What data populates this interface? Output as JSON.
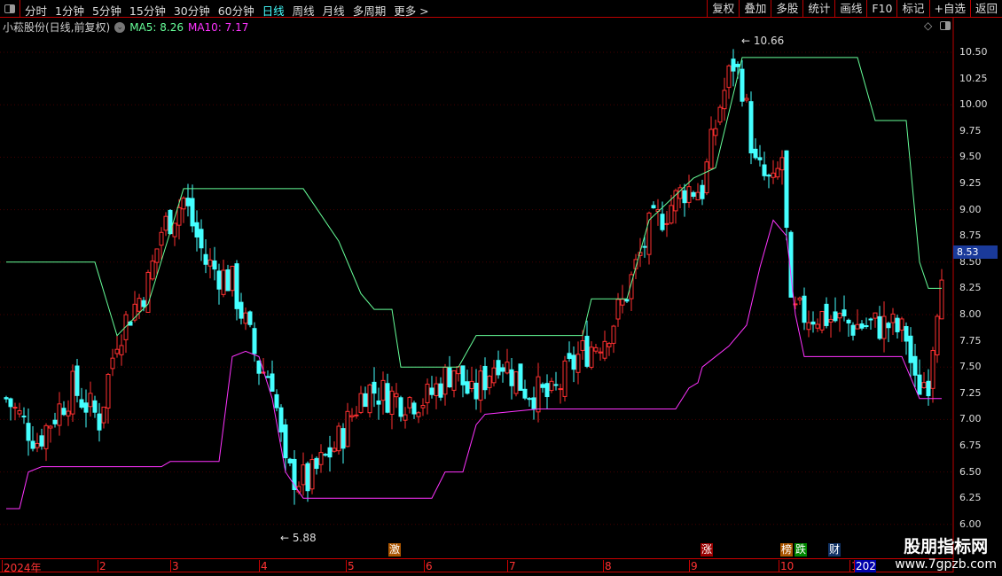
{
  "toolbar": {
    "periods": [
      "分时",
      "1分钟",
      "5分钟",
      "15分钟",
      "30分钟",
      "60分钟",
      "日线",
      "周线",
      "月线",
      "多周期",
      "更多 >"
    ],
    "active": "日线",
    "buttons": [
      "复权",
      "叠加",
      "多股",
      "统计",
      "画线",
      "F10",
      "标记",
      "+自选",
      "返回"
    ]
  },
  "info": {
    "title": "小菘股份(日线,前复权)",
    "ma5": "MA5: 8.26",
    "ma10": "MA10: 7.17"
  },
  "colors": {
    "up": "#ff3030",
    "down": "#44ffff",
    "ma5": "#66ff99",
    "ma10": "#ff33ff"
  },
  "chart_data": {
    "type": "candlestick",
    "ylim": [
      6.0,
      10.5
    ],
    "yticks": [
      "10.50",
      "10.25",
      "10.00",
      "9.75",
      "9.50",
      "9.25",
      "9.00",
      "8.75",
      "8.50",
      "8.25",
      "8.00",
      "7.75",
      "7.50",
      "7.25",
      "7.00",
      "6.75",
      "6.50",
      "6.25",
      "6.00"
    ],
    "close_path": [
      [
        0,
        7.2
      ],
      [
        7,
        6.8
      ],
      [
        15,
        7.3
      ],
      [
        21,
        7.0
      ],
      [
        25,
        7.8
      ],
      [
        32,
        8.3
      ],
      [
        35,
        8.8
      ],
      [
        40,
        9.1
      ],
      [
        45,
        8.5
      ],
      [
        51,
        8.3
      ],
      [
        57,
        7.5
      ],
      [
        60,
        7.4
      ],
      [
        63,
        6.5
      ],
      [
        68,
        6.4
      ],
      [
        75,
        6.8
      ],
      [
        81,
        7.3
      ],
      [
        89,
        7.2
      ],
      [
        95,
        7.2
      ],
      [
        101,
        7.5
      ],
      [
        105,
        7.2
      ],
      [
        111,
        7.6
      ],
      [
        117,
        7.3
      ],
      [
        123,
        7.2
      ],
      [
        129,
        7.6
      ],
      [
        135,
        7.8
      ],
      [
        139,
        8.1
      ],
      [
        145,
        8.8
      ],
      [
        153,
        9.2
      ],
      [
        157,
        9.2
      ],
      [
        161,
        10.0
      ],
      [
        164,
        10.4
      ],
      [
        166,
        10.2
      ],
      [
        169,
        9.4
      ],
      [
        173,
        9.2
      ],
      [
        175,
        9.5
      ],
      [
        177,
        8.0
      ],
      [
        183,
        8.0
      ],
      [
        191,
        7.9
      ],
      [
        199,
        7.9
      ],
      [
        203,
        7.8
      ],
      [
        205,
        7.3
      ],
      [
        208,
        7.4
      ],
      [
        211,
        8.5
      ]
    ],
    "ma5": [
      [
        0,
        8.5
      ],
      [
        20,
        8.5
      ],
      [
        25,
        7.8
      ],
      [
        32,
        8.1
      ],
      [
        40,
        9.2
      ],
      [
        67,
        9.2
      ],
      [
        75,
        8.7
      ],
      [
        80,
        8.2
      ],
      [
        83,
        8.05
      ],
      [
        87,
        8.05
      ],
      [
        89,
        7.5
      ],
      [
        102,
        7.5
      ],
      [
        106,
        7.8
      ],
      [
        130,
        7.8
      ],
      [
        132,
        8.15
      ],
      [
        140,
        8.15
      ],
      [
        145,
        8.9
      ],
      [
        155,
        9.3
      ],
      [
        160,
        9.4
      ],
      [
        166,
        10.45
      ],
      [
        192,
        10.45
      ],
      [
        196,
        9.85
      ],
      [
        203,
        9.85
      ],
      [
        206,
        8.5
      ],
      [
        208,
        8.25
      ],
      [
        211,
        8.25
      ]
    ],
    "ma10": [
      [
        0,
        6.15
      ],
      [
        3,
        6.15
      ],
      [
        5,
        6.5
      ],
      [
        8,
        6.55
      ],
      [
        35,
        6.55
      ],
      [
        37,
        6.6
      ],
      [
        48,
        6.6
      ],
      [
        51,
        7.6
      ],
      [
        54,
        7.65
      ],
      [
        57,
        7.6
      ],
      [
        60,
        7.2
      ],
      [
        63,
        6.5
      ],
      [
        67,
        6.25
      ],
      [
        96,
        6.25
      ],
      [
        99,
        6.5
      ],
      [
        103,
        6.5
      ],
      [
        106,
        6.95
      ],
      [
        108,
        7.05
      ],
      [
        120,
        7.1
      ],
      [
        151,
        7.1
      ],
      [
        154,
        7.3
      ],
      [
        156,
        7.35
      ],
      [
        157,
        7.5
      ],
      [
        163,
        7.7
      ],
      [
        167,
        7.9
      ],
      [
        170,
        8.45
      ],
      [
        173,
        8.9
      ],
      [
        176,
        8.75
      ],
      [
        178,
        8.0
      ],
      [
        180,
        7.6
      ],
      [
        202,
        7.6
      ],
      [
        206,
        7.2
      ],
      [
        211,
        7.2
      ]
    ],
    "high_label": "10.66",
    "low_label": "5.88",
    "last_price": "8.53",
    "months": [
      "2024年",
      "2",
      "3",
      "4",
      "5",
      "6",
      "7",
      "8",
      "9",
      "10",
      "1",
      "202"
    ],
    "events": [
      "激",
      "涨",
      "榜",
      "跌",
      "财"
    ]
  },
  "watermark": {
    "line1": "股朋指标网",
    "line2": "www.7gpzb.com"
  }
}
